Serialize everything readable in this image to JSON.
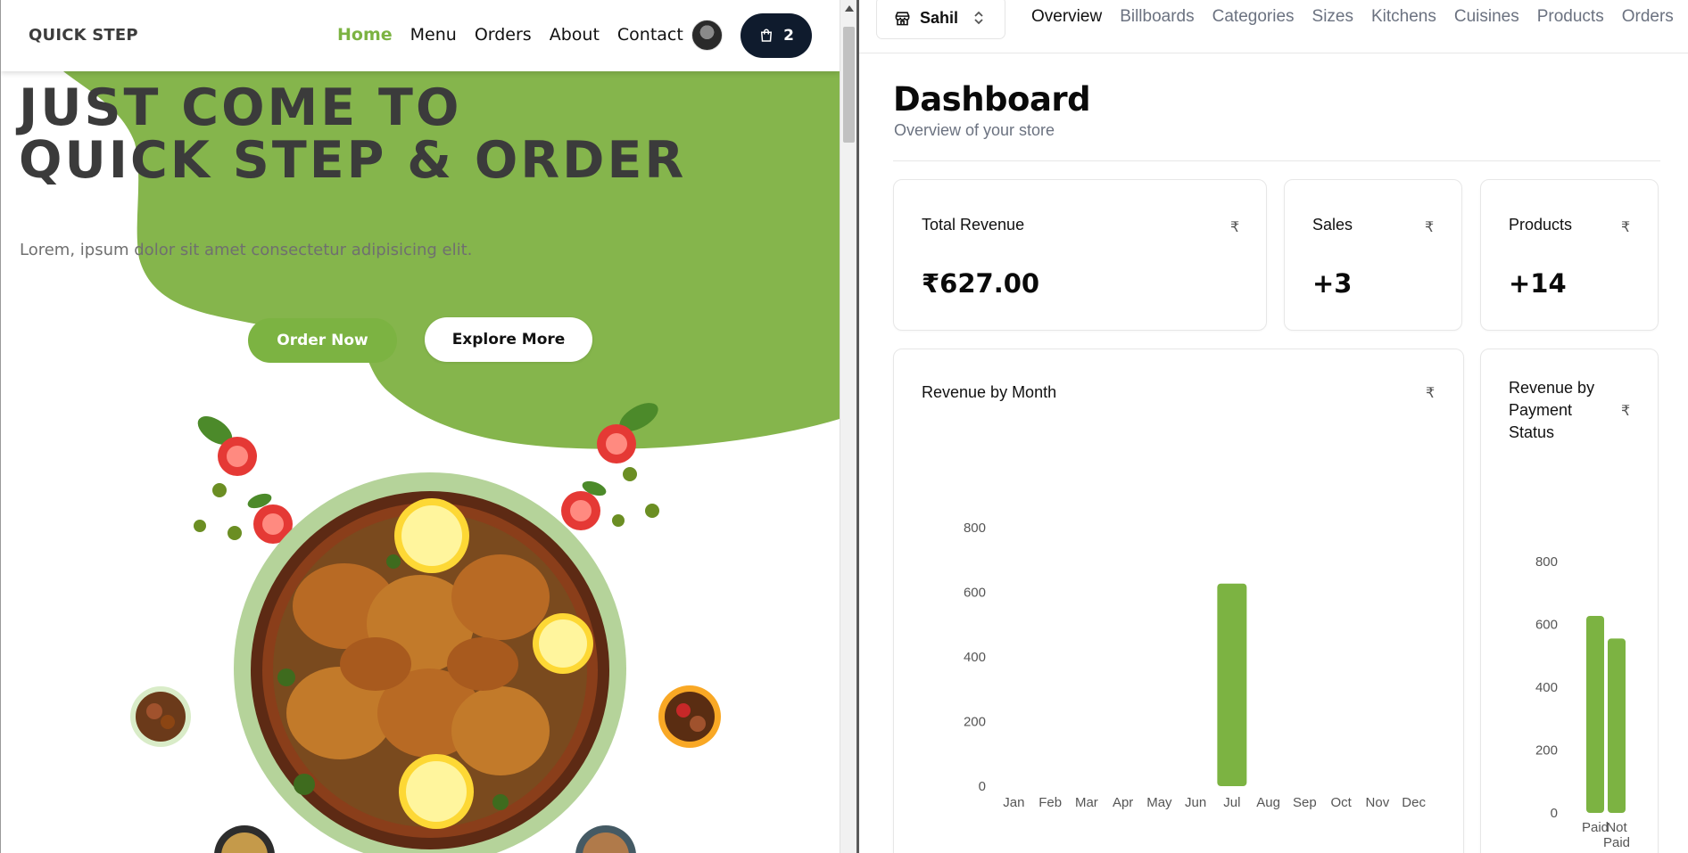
{
  "left": {
    "brand": "QUICK STEP",
    "nav": [
      {
        "label": "Home",
        "active": true
      },
      {
        "label": "Menu",
        "active": false
      },
      {
        "label": "Orders",
        "active": false
      },
      {
        "label": "About",
        "active": false
      },
      {
        "label": "Contact",
        "active": false
      }
    ],
    "cart_count": "2",
    "hero_title_line1": "JUST COME TO",
    "hero_title_line2": "QUICK STEP & ORDER",
    "hero_subtitle": "Lorem, ipsum dolor sit amet consectetur adipisicing elit.",
    "order_button": "Order Now",
    "explore_button": "Explore More",
    "accent_color": "#7cb342"
  },
  "right": {
    "store_name": "Sahil",
    "tabs": [
      {
        "label": "Overview",
        "active": true
      },
      {
        "label": "Billboards",
        "active": false
      },
      {
        "label": "Categories",
        "active": false
      },
      {
        "label": "Sizes",
        "active": false
      },
      {
        "label": "Kitchens",
        "active": false
      },
      {
        "label": "Cuisines",
        "active": false
      },
      {
        "label": "Products",
        "active": false
      },
      {
        "label": "Orders",
        "active": false
      }
    ],
    "title": "Dashboard",
    "subtitle": "Overview of your store",
    "currency_icon": "₹",
    "stats": [
      {
        "label": "Total Revenue",
        "value": "₹627.00"
      },
      {
        "label": "Sales",
        "value": "+3"
      },
      {
        "label": "Products",
        "value": "+14"
      }
    ],
    "chart_data": [
      {
        "type": "bar",
        "title": "Revenue by Month",
        "categories": [
          "Jan",
          "Feb",
          "Mar",
          "Apr",
          "May",
          "Jun",
          "Jul",
          "Aug",
          "Sep",
          "Oct",
          "Nov",
          "Dec"
        ],
        "values": [
          0,
          0,
          0,
          0,
          0,
          0,
          627,
          0,
          0,
          0,
          0,
          0
        ],
        "yticks": [
          0,
          200,
          400,
          600,
          800
        ],
        "ylim": [
          0,
          800
        ],
        "color": "#7cb342",
        "grid": false
      },
      {
        "type": "bar",
        "title": "Revenue by Payment Status",
        "categories": [
          "Paid",
          "Not Paid"
        ],
        "values": [
          627,
          555
        ],
        "yticks": [
          0,
          200,
          400,
          600,
          800
        ],
        "ylim": [
          0,
          800
        ],
        "color": "#7cb342",
        "grid": false
      }
    ]
  }
}
